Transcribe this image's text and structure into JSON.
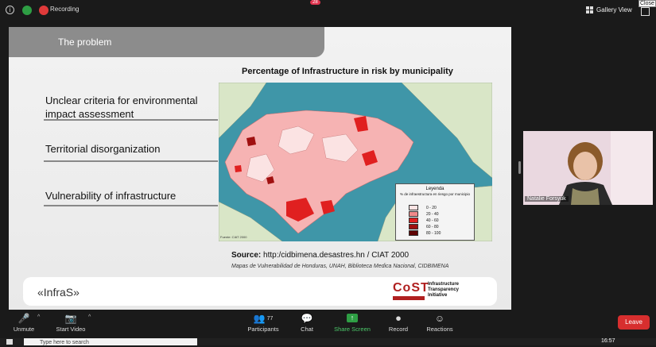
{
  "topbar": {
    "recording_label": "Recording",
    "view_label": "Gallery View",
    "close_tooltip": "Close"
  },
  "slide": {
    "header": "The problem",
    "bullets": [
      "Unclear criteria for environmental\nimpact assessment",
      "Territorial disorganization",
      "Vulnerability of  infrastructure"
    ],
    "map_title": "Percentage of Infrastructure in risk by municipality",
    "legend": {
      "title": "Leyenda",
      "subtitle": "% de infraestructura en riesgo por municipio",
      "rows": [
        {
          "label": "0 - 20",
          "color": "#fbe3e3"
        },
        {
          "label": "20 - 40",
          "color": "#f08a8a"
        },
        {
          "label": "40 - 60",
          "color": "#e02020"
        },
        {
          "label": "60 - 80",
          "color": "#a01010"
        },
        {
          "label": "80 - 100",
          "color": "#600505"
        }
      ]
    },
    "map_credit": "Fuente:  CIAT 2000",
    "source_label": "Source:",
    "source_text": " http:/cidbimena.desastres.hn / CIAT 2000",
    "source_sub": "Mapas de Vulnerabilidad de Honduras, UNAH, Biblioteca Medica Nacional, CIDBIMENA",
    "footer_text": "«InfraS»",
    "logo_word": "CoST",
    "logo_side": "Infrastructure\nTransparency\nInitiative"
  },
  "participant": {
    "name": "Natalie Forsyuk"
  },
  "toolbar": {
    "unmute": "Unmute",
    "start_video": "Start Video",
    "participants": "Participants",
    "participants_count": "77",
    "chat": "Chat",
    "chat_badge": "28",
    "share": "Share Screen",
    "record": "Record",
    "reactions": "Reactions",
    "leave": "Leave"
  },
  "taskbar": {
    "search_placeholder": "Type here to search",
    "time": "16:57"
  },
  "colors": {
    "accent_green": "#2e9e44",
    "leave_red": "#d72e2e",
    "badge_red": "#e0334e"
  }
}
